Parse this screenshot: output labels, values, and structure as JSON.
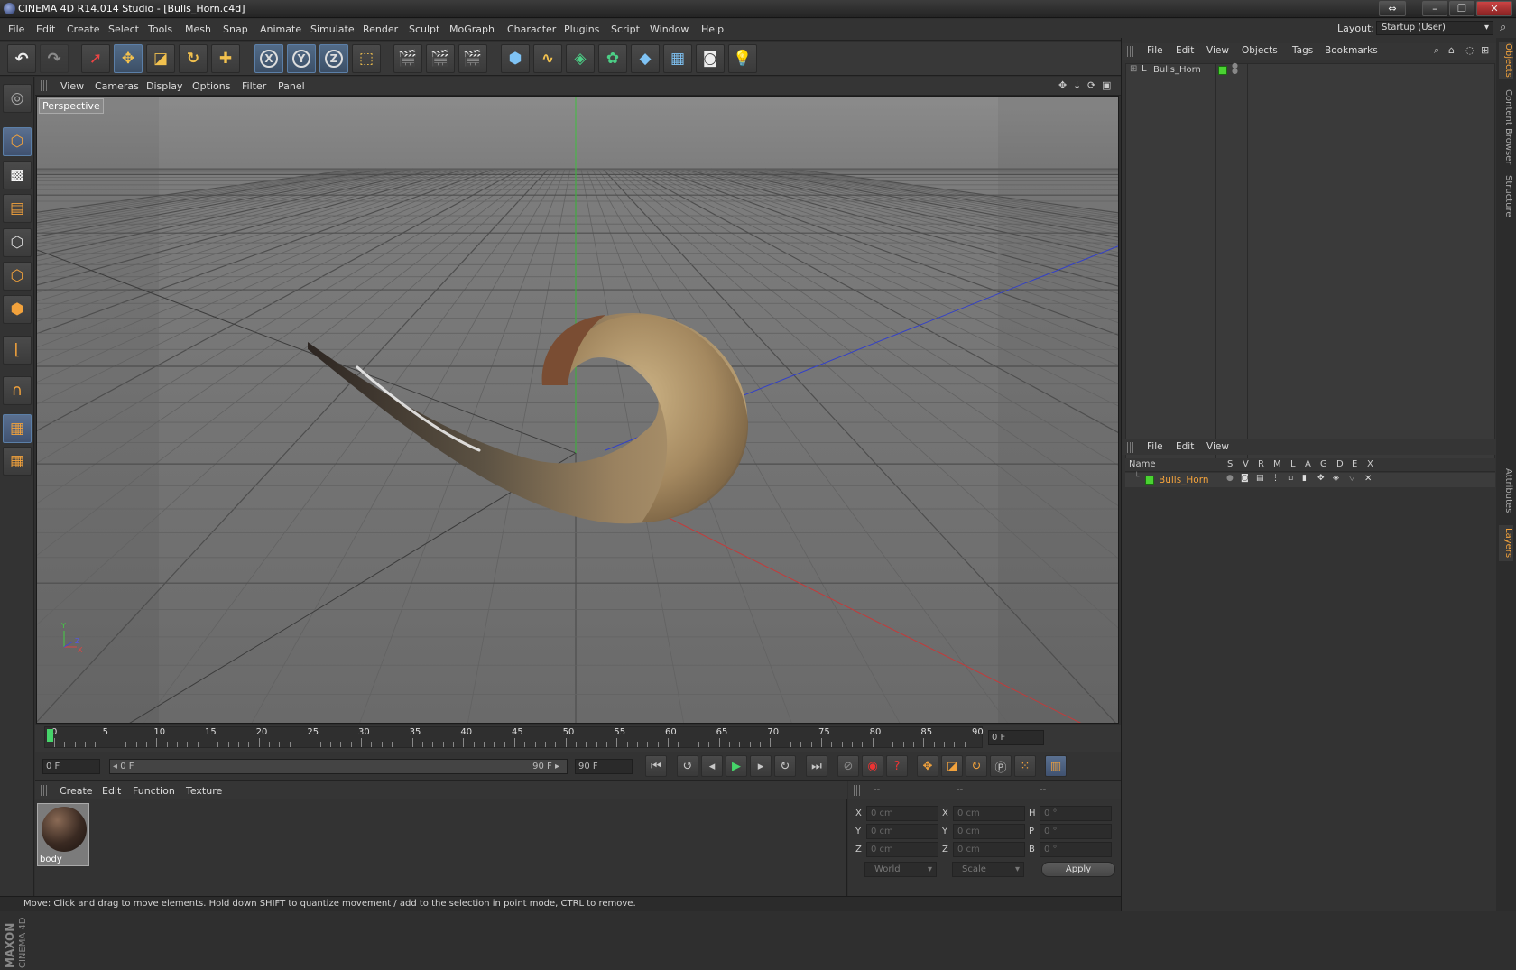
{
  "window": {
    "title": "CINEMA 4D R14.014 Studio - [Bulls_Horn.c4d]"
  },
  "menu": [
    "File",
    "Edit",
    "Create",
    "Select",
    "Tools",
    "Mesh",
    "Snap",
    "Animate",
    "Simulate",
    "Render",
    "Sculpt",
    "MoGraph",
    "Character",
    "Plugins",
    "Script",
    "Window",
    "Help"
  ],
  "layout": {
    "label": "Layout:",
    "value": "Startup (User)"
  },
  "toolbar": {
    "x_axis": "X",
    "y_axis": "Y",
    "z_axis": "Z"
  },
  "viewport": {
    "menu": [
      "View",
      "Cameras",
      "Display",
      "Options",
      "Filter",
      "Panel"
    ],
    "label": "Perspective",
    "axis_x": "X",
    "axis_y": "Y",
    "axis_z": "Z"
  },
  "timeline": {
    "ticks": [
      "0",
      "5",
      "10",
      "15",
      "20",
      "25",
      "30",
      "35",
      "40",
      "45",
      "50",
      "55",
      "60",
      "65",
      "70",
      "75",
      "80",
      "85",
      "90"
    ],
    "current_frame": "0 F",
    "start": "0 F",
    "range_start": "0 F",
    "range_end": "90 F",
    "end": "90 F"
  },
  "material_manager": {
    "menu": [
      "Create",
      "Edit",
      "Function",
      "Texture"
    ],
    "material": {
      "name": "body"
    }
  },
  "coordinates": {
    "headers": [
      "--",
      "--",
      "--"
    ],
    "rows": [
      {
        "l1": "X",
        "v1": "0 cm",
        "l2": "X",
        "v2": "0 cm",
        "l3": "H",
        "v3": "0 °"
      },
      {
        "l1": "Y",
        "v1": "0 cm",
        "l2": "Y",
        "v2": "0 cm",
        "l3": "P",
        "v3": "0 °"
      },
      {
        "l1": "Z",
        "v1": "0 cm",
        "l2": "Z",
        "v2": "0 cm",
        "l3": "B",
        "v3": "0 °"
      }
    ],
    "mode1": "World",
    "mode2": "Scale",
    "apply": "Apply"
  },
  "status": "Move: Click and drag to move elements. Hold down SHIFT to quantize movement / add to the selection in point mode, CTRL to remove.",
  "object_manager": {
    "menu": [
      "File",
      "Edit",
      "View",
      "Objects",
      "Tags",
      "Bookmarks"
    ],
    "object": "Bulls_Horn"
  },
  "layer_manager": {
    "menu": [
      "File",
      "Edit",
      "View"
    ],
    "columns": [
      "Name",
      "S",
      "V",
      "R",
      "M",
      "L",
      "A",
      "G",
      "D",
      "E",
      "X"
    ],
    "layer": "Bulls_Horn"
  },
  "side_tabs": [
    "Objects",
    "Content Browser",
    "Structure",
    "Attributes",
    "Layers"
  ],
  "brand": {
    "line1": "MAXON",
    "line2": "CINEMA 4D"
  },
  "colors": {
    "accent": "#f2a23c",
    "selected": "#5b7fa8",
    "layer_green": "#4ad232",
    "layer_name": "#f2a23c"
  }
}
